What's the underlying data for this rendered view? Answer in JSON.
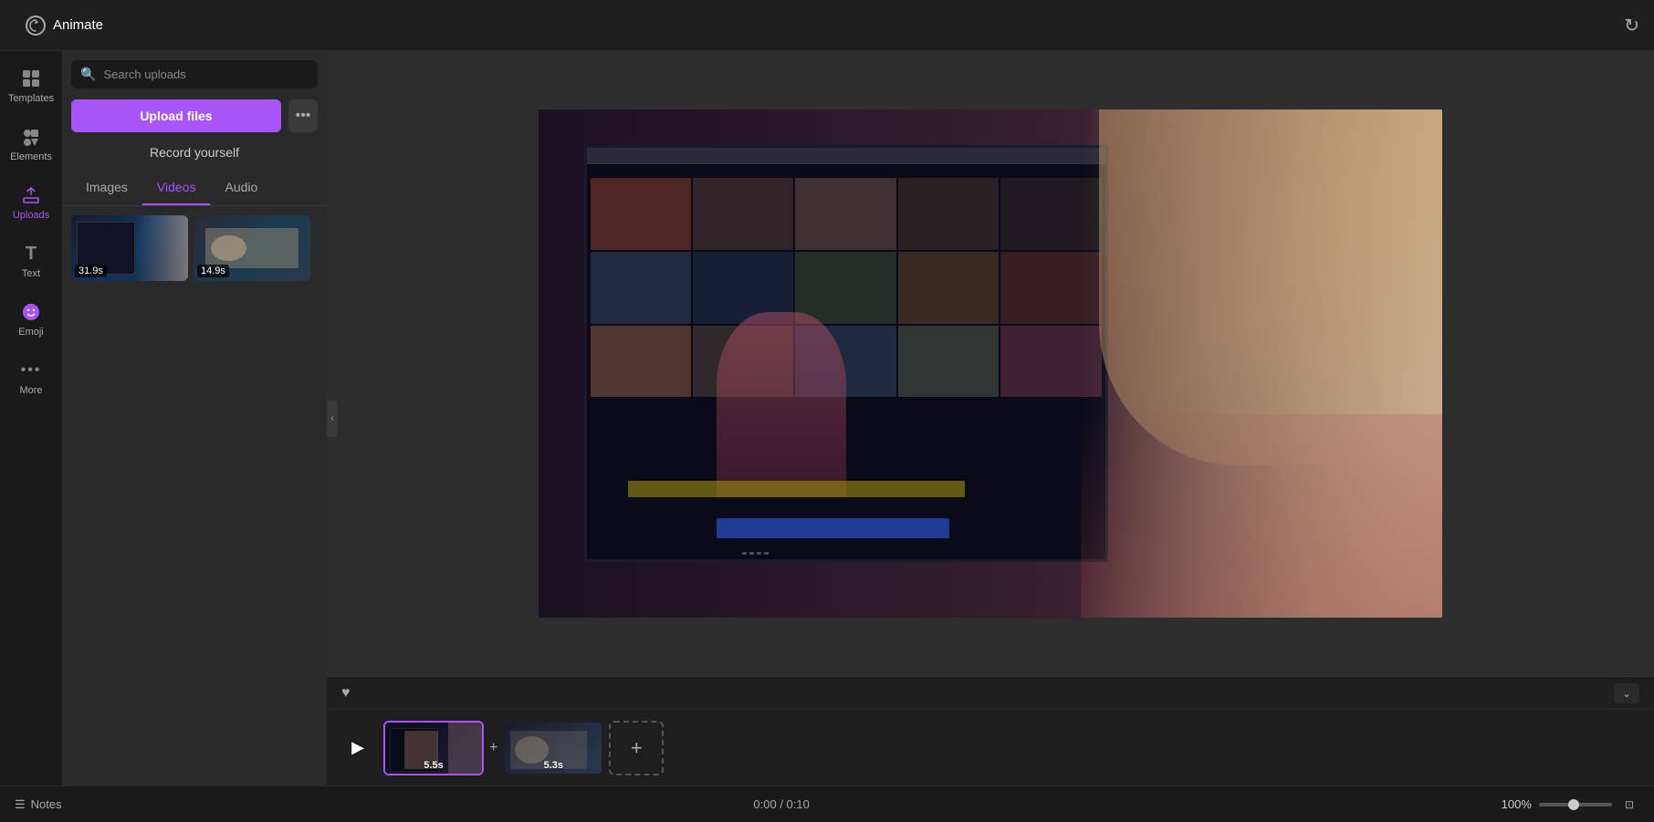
{
  "topbar": {
    "animate_label": "Animate"
  },
  "sidebar": {
    "items": [
      {
        "id": "templates",
        "label": "Templates",
        "icon": "⊞"
      },
      {
        "id": "elements",
        "label": "Elements",
        "icon": "✦"
      },
      {
        "id": "uploads",
        "label": "Uploads",
        "icon": "⬆"
      },
      {
        "id": "text",
        "label": "Text",
        "icon": "T"
      },
      {
        "id": "emoji",
        "label": "Emoji",
        "icon": "😊"
      },
      {
        "id": "more",
        "label": "More",
        "icon": "···"
      }
    ]
  },
  "uploads_panel": {
    "search_placeholder": "Search uploads",
    "upload_btn_label": "Upload files",
    "record_label": "Record yourself",
    "tabs": [
      "Images",
      "Videos",
      "Audio"
    ],
    "active_tab": "Videos",
    "more_icon": "···",
    "videos": [
      {
        "id": "vid1",
        "duration": "31.9s"
      },
      {
        "id": "vid2",
        "duration": "14.9s"
      }
    ]
  },
  "timeline": {
    "clips": [
      {
        "id": "clip1",
        "duration": "5.5s",
        "active": true
      },
      {
        "id": "clip2",
        "duration": "5.3s",
        "active": false
      }
    ],
    "add_label": "+"
  },
  "statusbar": {
    "notes_label": "Notes",
    "time_current": "0:00",
    "time_total": "0:10",
    "time_display": "0:00 / 0:10",
    "zoom_level": "100%",
    "fit_label": "⊡"
  }
}
